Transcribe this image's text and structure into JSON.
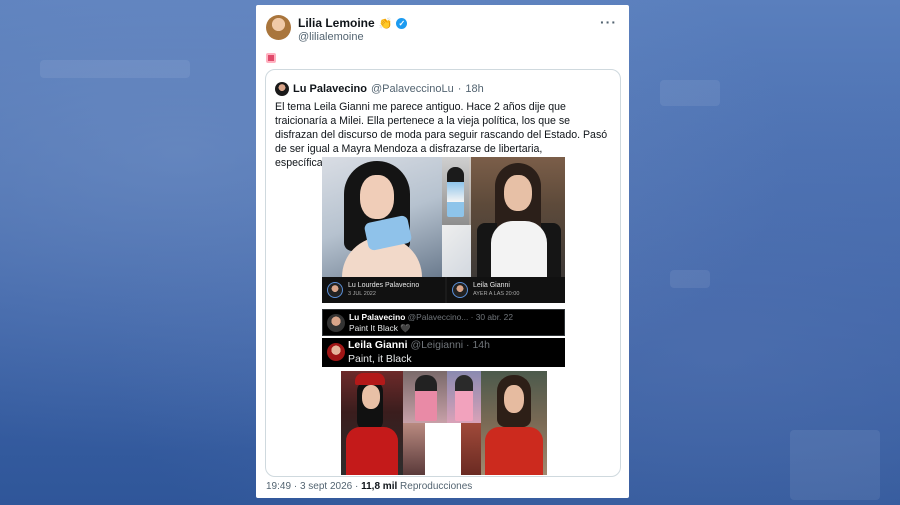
{
  "author": {
    "name": "Lilia Lemoine",
    "emoji": "👏",
    "handle": "@lilialemoine"
  },
  "tweet": {
    "icon": "instagram-icon",
    "time": "19:49",
    "separator": "·",
    "date": "3 sept 2026",
    "views_count": "11,8 mil",
    "views_label": "Reproducciones"
  },
  "quoted": {
    "name": "Lu Palavecino",
    "handle": "@PalaveccinoLu",
    "separator": "·",
    "age": "18h",
    "text": "El tema Leila Gianni me parece antiguo. Hace 2 años dije que traicionaría a Milei. Ella pertenece a la vieja política, los que se disfrazan del discurso de moda para seguir rascando del Estado. Pasó de ser igual a Mayra Mendoza a disfrazarse de libertaria, específicamente de mí."
  },
  "media": {
    "collage_captions": [
      {
        "name": "Lu Lourdes Palavecino",
        "date": "3 JUL 2022"
      },
      {
        "name": "Leila Gianni",
        "date": "AYER A LAS 20:00"
      }
    ],
    "screenshot_1": {
      "name": "Lu Palavecino",
      "meta": "@Palaveccino... · 30 abr. 22",
      "text": "Paint It Black 🖤"
    },
    "screenshot_2": {
      "name": "Leila Gianni",
      "meta": "@Leigianni · 14h",
      "text": "Paint, it Black"
    }
  },
  "colors": {
    "verified": "#1d9bf0",
    "background": "#3f68ad",
    "text_secondary": "#536471"
  }
}
